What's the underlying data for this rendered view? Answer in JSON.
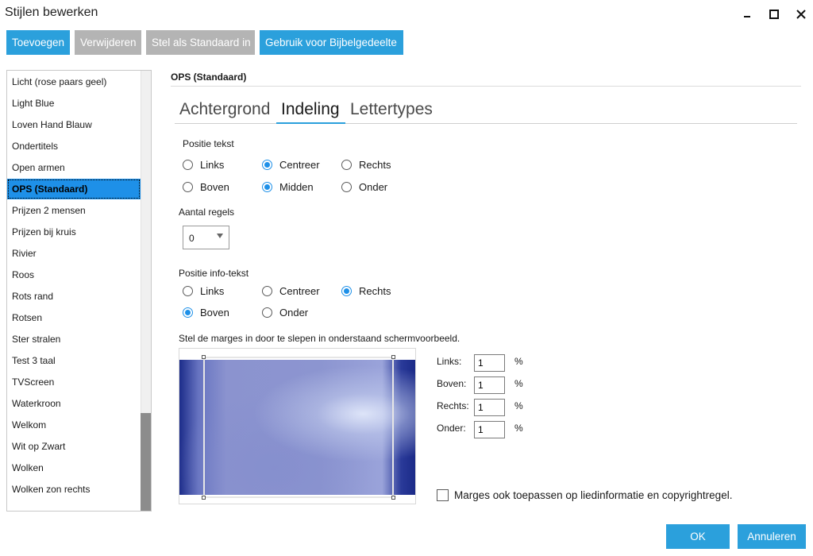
{
  "window": {
    "title": "Stijlen bewerken",
    "controls": [
      "minimize-icon",
      "maximize-icon",
      "close-icon"
    ]
  },
  "toolbar": {
    "add_label": "Toevoegen",
    "remove_label": "Verwijderen",
    "set_default_label": "Stel als Standaard in",
    "use_for_bible_label": "Gebruik voor Bijbelgedeelte"
  },
  "styles_list": {
    "items": [
      "Licht (rose paars geel)",
      "Light Blue",
      "Loven Hand Blauw",
      "Ondertitels",
      "Open armen",
      "OPS (Standaard)",
      "Prijzen 2 mensen",
      "Prijzen bij kruis",
      "Rivier",
      "Roos",
      "Rots rand",
      "Rotsen",
      "Ster stralen",
      "Test 3 taal",
      "TVScreen",
      "Waterkroon",
      "Welkom",
      "Wit op Zwart",
      "Wolken",
      "Wolken zon rechts"
    ],
    "selected": "OPS (Standaard)"
  },
  "editor": {
    "style_title": "OPS (Standaard)",
    "tabs": [
      "Achtergrond",
      "Indeling",
      "Lettertypes"
    ],
    "active_tab": "Indeling",
    "text_position": {
      "label": "Positie tekst",
      "horizontal": [
        "Links",
        "Centreer",
        "Rechts"
      ],
      "vertical": [
        "Boven",
        "Midden",
        "Onder"
      ],
      "horizontal_selected": "Centreer",
      "vertical_selected": "Midden"
    },
    "line_count": {
      "label": "Aantal regels",
      "value": "0"
    },
    "info_position": {
      "label": "Positie info-tekst",
      "horizontal": [
        "Links",
        "Centreer",
        "Rechts"
      ],
      "vertical": [
        "Boven",
        "Onder"
      ],
      "horizontal_selected": "Rechts",
      "vertical_selected": "Boven"
    },
    "margins": {
      "instruction": "Stel de marges in door te slepen in onderstaand schermvoorbeeld.",
      "left_label": "Links:",
      "left_value": "1",
      "top_label": "Boven:",
      "top_value": "1",
      "right_label": "Rechts:",
      "right_value": "1",
      "bottom_label": "Onder:",
      "bottom_value": "1",
      "unit": "%",
      "apply_checkbox_label": "Marges ook toepassen op liedinformatie en copyrightregel.",
      "apply_checked": false
    }
  },
  "footer": {
    "ok_label": "OK",
    "cancel_label": "Annuleren"
  },
  "colors": {
    "accent": "#2ba0dc",
    "disabled": "#b4b4b4",
    "selection": "#1e90e8"
  }
}
